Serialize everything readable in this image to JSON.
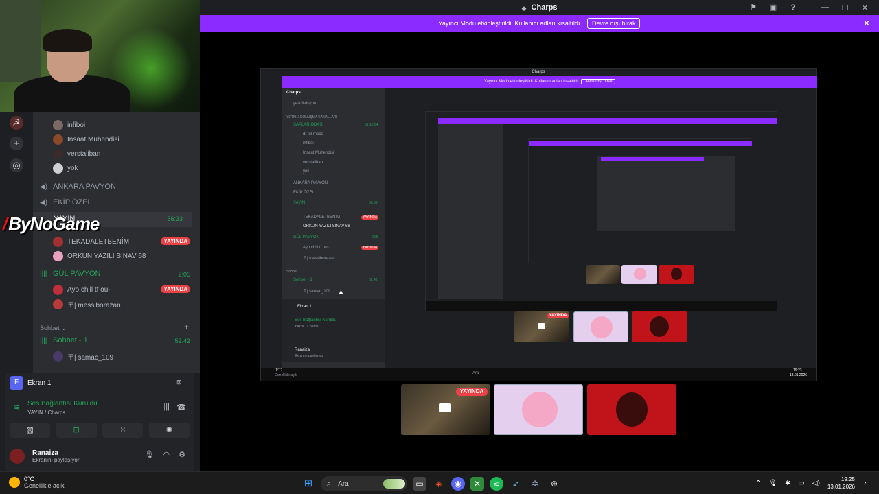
{
  "window": {
    "title": "Charps"
  },
  "banner": {
    "text": "Yayıncı Modu etkinleştirildi. Kullanıcı adları kısaltıldı.",
    "button": "Devre dışı bırak"
  },
  "sidebar": {
    "voice_users_top": [
      "infiboi",
      "Insaat Muhendisi",
      "verstaliban",
      "yok"
    ],
    "channels": {
      "ankara": "ANKARA PAVYON",
      "ekip": "EKİP ÖZEL",
      "yayin": "YAYIN",
      "yayin_timer": "56:33",
      "gul": "GÜL PAVYON",
      "gul_timer": "2:05",
      "sohbet1": "Sohbet - 1",
      "sohbet1_timer": "52:42"
    },
    "yayin_users": [
      "TEKADALETBENİM",
      "ORKUN YAZILI SINAV 68"
    ],
    "gul_users": [
      "Ayo chill tf ou-",
      "〒| messiborazan"
    ],
    "sohbet_users": [
      "〒| samac_109"
    ],
    "category": "Sohbet",
    "live_badge": "YAYINDA",
    "brand": "ByNoGame"
  },
  "share": {
    "title": "Ekran 1",
    "connected": "Ses Bağlantısı Kuruldu",
    "connected_sub": "YAYIN / Charps",
    "user": "Ranaiza",
    "user_status": "Ekranını paylaşıyor"
  },
  "nested": {
    "title": "Charps",
    "banner_text": "Yayıncı Modu etkinleştirildi. Kullanıcı adları kısaltıldı.",
    "banner_btn": "Devre dışı bırak",
    "server": "Charps",
    "ch_first": "yetkili-duyuru",
    "cat": "YETKİLİ KONUŞMA KANALLARI",
    "saplar": "SAPLAR ODASI",
    "saplar_timer": "01:15:54",
    "saplar_users": [
      "dr tel mooo",
      "infiboi",
      "Insaat Muhendisi",
      "verstaliban",
      "yok"
    ],
    "ankara": "ANKARA PAVYON",
    "ekip": "EKİP ÖZEL",
    "yayin": "YAYIN",
    "yayin_timer": "56:33",
    "yayin_users": [
      "TEKADALETBENİM",
      "ORKUN YAZILI SINAV 68"
    ],
    "gul": "GÜL PAVYON",
    "gul_timer": "2:05",
    "gul_users": [
      "Ayo chill tf ou-",
      "〒| messiborazan"
    ],
    "cat2": "Sohbet",
    "sohbet1": "Sohbet - 1",
    "sohbet1_timer": "52:42",
    "sohbet_users": [
      "〒| samac_109"
    ],
    "share_title": "Ekran 1",
    "connected": "Ses Bağlantısı Kuruldu",
    "connected_sub": "YAYIN / Charps",
    "user": "Ranaiza",
    "user_status": "Ekranını paylaşıyor",
    "weather_temp": "0°C",
    "weather_desc": "Genellikle açık",
    "search": "Ara",
    "time": "19:23",
    "date": "13.01.2026",
    "live": "YAYINDA"
  },
  "stage": {
    "live_badge": "YAYINDA"
  },
  "taskbar": {
    "weather_temp": "0°C",
    "weather_desc": "Genellikle açık",
    "search": "Ara",
    "time": "19:25",
    "date": "13.01.2026"
  },
  "icons": [
    "discord-icon",
    "pin-icon",
    "inbox-icon",
    "help-icon",
    "minimize-icon",
    "maximize-icon",
    "close-icon",
    "speaker-icon",
    "mic-icon",
    "headphones-icon",
    "settings-icon",
    "windows-icon",
    "search-icon"
  ]
}
